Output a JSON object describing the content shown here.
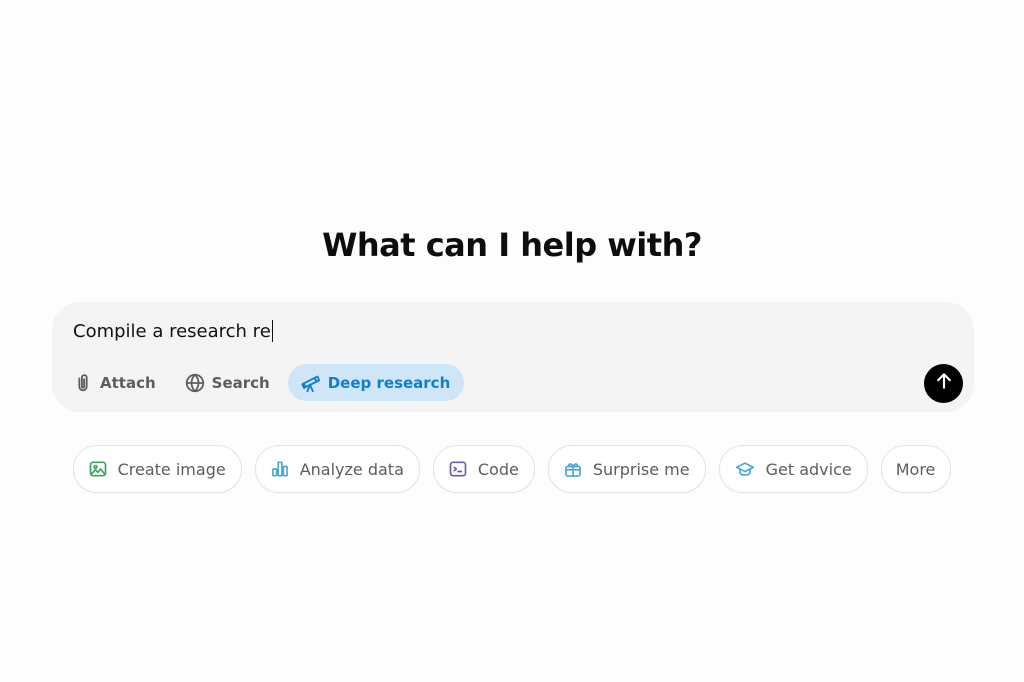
{
  "heading": "What can I help with?",
  "composer": {
    "input_value": "Compile a research re",
    "tools": [
      {
        "label": "Attach",
        "icon": "paperclip-icon"
      },
      {
        "label": "Search",
        "icon": "globe-icon"
      },
      {
        "label": "Deep research",
        "icon": "telescope-icon",
        "active": true
      }
    ],
    "send_icon": "arrow-up-icon"
  },
  "suggestions": [
    {
      "label": "Create image",
      "icon": "image-icon",
      "color": "#3aa55a"
    },
    {
      "label": "Analyze data",
      "icon": "bar-chart-icon",
      "color": "#4aa8d8"
    },
    {
      "label": "Code",
      "icon": "terminal-icon",
      "color": "#6b5bb0"
    },
    {
      "label": "Surprise me",
      "icon": "gift-icon",
      "color": "#4aa8d8"
    },
    {
      "label": "Get advice",
      "icon": "graduation-cap-icon",
      "color": "#4aa8d8"
    },
    {
      "label": "More"
    }
  ],
  "colors": {
    "background": "#fdfdfd",
    "composer_bg": "#f4f4f4",
    "active_tool_bg": "#cfe5f8",
    "active_tool_text": "#0f7fd0",
    "send_button": "#000000"
  }
}
